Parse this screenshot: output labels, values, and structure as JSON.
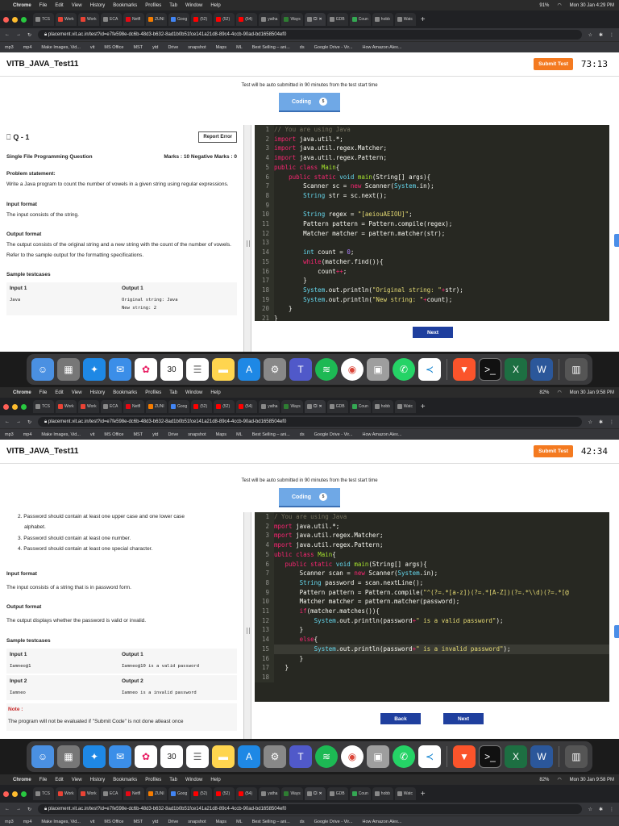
{
  "menubar": {
    "app": "Chrome",
    "items": [
      "File",
      "Edit",
      "View",
      "History",
      "Bookmarks",
      "Profiles",
      "Tab",
      "Window",
      "Help"
    ]
  },
  "tabs": [
    {
      "label": "TCS"
    },
    {
      "label": "Work"
    },
    {
      "label": "Work"
    },
    {
      "label": "ECA"
    },
    {
      "label": "Netfl"
    },
    {
      "label": "ZUNI"
    },
    {
      "label": "Goog"
    },
    {
      "label": "(52)"
    },
    {
      "label": "(52)"
    },
    {
      "label": "(54)"
    },
    {
      "label": "yatha"
    },
    {
      "label": "Ways"
    },
    {
      "label": "Cl",
      "active": true
    },
    {
      "label": "GDB"
    },
    {
      "label": "Coun"
    },
    {
      "label": "hobb"
    },
    {
      "label": "Watc"
    }
  ],
  "url": "placement.vit.ac.in/test?id=e7fe598e-dc6b-48d3-b632-8ad1b0b51fce141a21d8-89c4-4ccb-90ad-bd1658504ef0",
  "bookmarks": [
    "mp3",
    "mp4",
    "Make Images, Vid...",
    "vit",
    "MS Office",
    "MST",
    "ytd",
    "Drive",
    "snapshot",
    "Maps",
    "ML",
    "Best Selling – ani...",
    "ds",
    "Google Drive - Vir...",
    "How Amazon Alex..."
  ],
  "app": {
    "title": "VITB_JAVA_Test11",
    "submit_label": "Submit Test",
    "notice": "Test will be auto submitted in 90 minutes from the test start time",
    "coding_tab": "Coding",
    "coding_badge": "5"
  },
  "frames": [
    {
      "clock": "Mon 30 Jan 4:29 PM",
      "battery": "91%",
      "timer": "73:13",
      "question": {
        "number": "Q - 1",
        "report": "Report Error",
        "type": "Single File Programming Question",
        "marks": "Marks : 10  Negative Marks : 0",
        "ps_head": "Problem statement:",
        "ps_text": "Write a Java program to count the number of vowels in a given string using regular expressions.",
        "if_head": "Input format",
        "if_text": "The input consists of the string.",
        "of_head": "Output format",
        "of_text": "The output consists of the original string and a new string with the count of the number of vowels. Refer to the sample output for the formatting specifications.",
        "st_head": "Sample testcases",
        "in1_head": "Input 1",
        "out1_head": "Output 1",
        "in1": "Java",
        "out1_a": "Original string: Java",
        "out1_b": "New string: 2"
      },
      "next_label": "Next"
    },
    {
      "clock": "Mon 30 Jan 9:58 PM",
      "battery": "82%",
      "timer": "42:34",
      "question": {
        "rule2": "2. Password should contain at least one upper case and one lower case",
        "rule2b": "alphabet.",
        "rule3": "3. Password should contain at least one number.",
        "rule4": "4. Password should contain at least one special character.",
        "if_head": "Input format",
        "if_text": "The input consists of a string that is in password form.",
        "of_head": "Output format",
        "of_text": "The output displays whether the password is valid or invalid.",
        "st_head": "Sample testcases",
        "in1_head": "Input 1",
        "out1_head": "Output 1",
        "in1": "Iamneo@1",
        "out1": "Iamneo@10 is a valid password",
        "in2_head": "Input 2",
        "out2_head": "Output 2",
        "in2": "Iamneo",
        "out2": "Iamneo is a invalid password",
        "note_head": "Note :",
        "note_text": "The program will not be evaluated if \"Submit Code\" is not done atleast once"
      },
      "back_label": "Back",
      "next_label": "Next"
    },
    {
      "clock": "Mon 30 Jan 9:58 PM",
      "battery": "82%"
    }
  ]
}
